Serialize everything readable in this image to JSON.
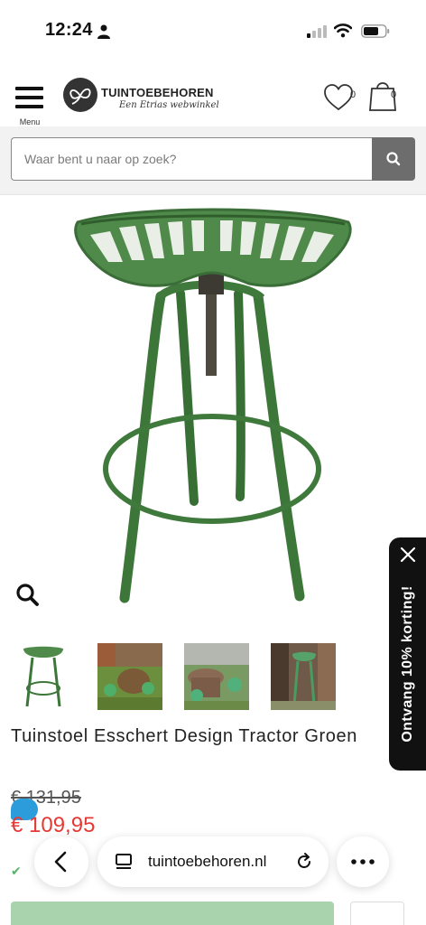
{
  "status_bar": {
    "time": "12:24"
  },
  "header": {
    "menu_label": "Menu",
    "logo_title": "TUINTOEBEHOREN",
    "logo_subtitle": "Een Etrias webwinkel",
    "wishlist_count": "0",
    "cart_count": "0"
  },
  "search": {
    "placeholder": "Waar bent u naar op zoek?"
  },
  "product": {
    "title": "Tuinstoel Esschert Design Tractor Groen",
    "old_price": "€ 131,95",
    "new_price": "€ 109,95"
  },
  "promo": {
    "label": "Ontvang 10% korting!"
  },
  "browser": {
    "url": "tuintoebehoren.nl"
  },
  "colors": {
    "accent_red": "#e53935",
    "stool_green": "#3f7a3c",
    "promo_bg": "#111111",
    "cart_green": "#a9d3ac"
  }
}
